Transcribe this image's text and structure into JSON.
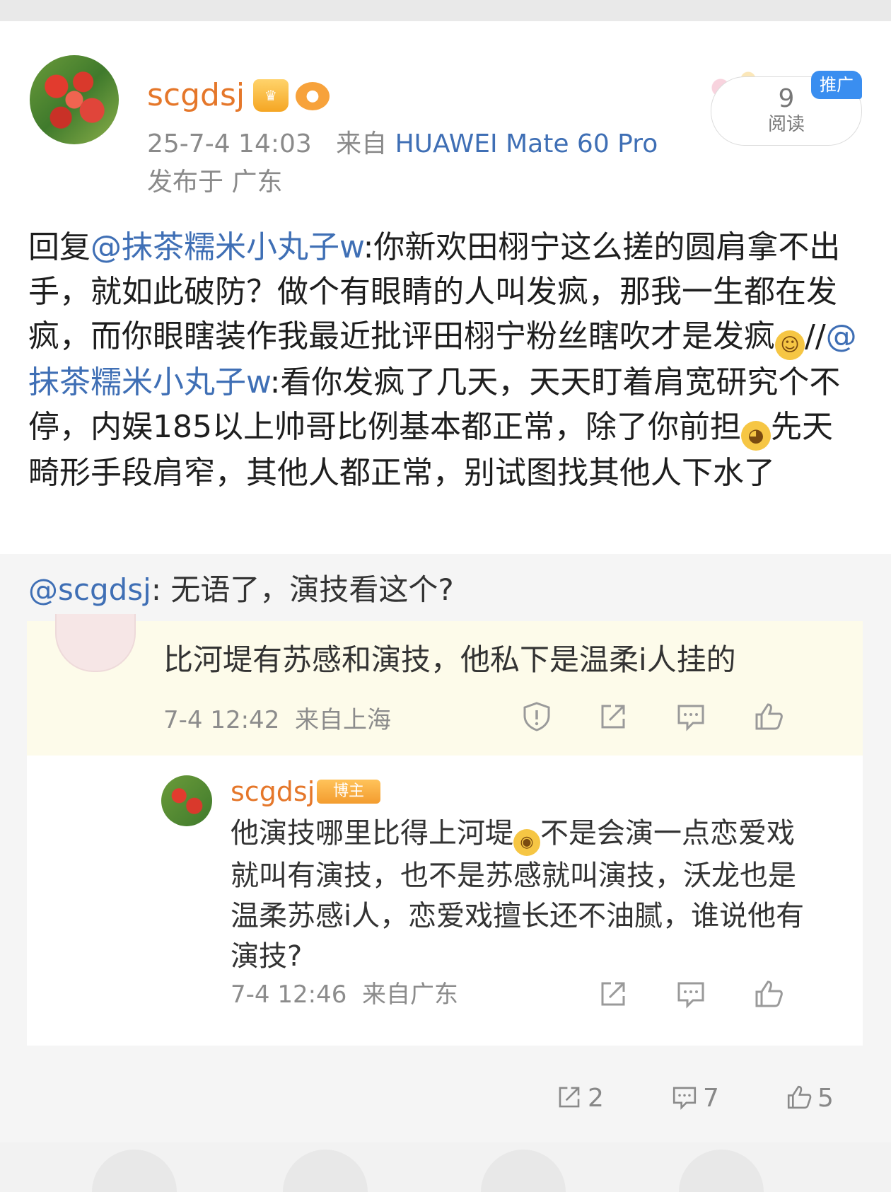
{
  "post": {
    "username": "scgdsj",
    "vip_badge_icon": "crown-vip-icon",
    "fan_badge_icon": "fish-icon",
    "timestamp": "25-7-4 14:03",
    "source_prefix": "来自",
    "device": "HUAWEI Mate 60 Pro",
    "location": "发布于 广东",
    "read_count": "9",
    "read_label": "阅读",
    "promo_label": "推广",
    "body": {
      "p1": "回复",
      "m1": "@抹茶糯米小丸子w",
      "p2": ":你新欢田栩宁这么搓的圆肩拿不出手，就如此破防？做个有眼睛的人叫发疯，那我一生都在发疯，而你眼瞎装作我最近批评田栩宁粉丝瞎吹才是发疯",
      "p3": "//",
      "m2": "@抹茶糯米小丸子w",
      "p4": ":看你发疯了几天，天天盯着肩宽研究个不停，内娱185以上帅哥比例基本都正常，除了你前担",
      "p5": "先天畸形手段肩窄，其他人都正常，别试图找其他人下水了"
    }
  },
  "quote": {
    "mention": "@scgdsj",
    "text": ": 无语了，演技看这个?"
  },
  "screenshot": {
    "comment1": {
      "text": "比河堤有苏感和演技，他私下是温柔i人挂的",
      "time": "7-4 12:42",
      "location": "来自上海"
    },
    "reply": {
      "name": "scgdsj",
      "badge": "博主",
      "text_a": "他演技哪里比得上河堤",
      "text_b": "不是会演一点恋爱戏就叫有演技，也不是苏感就叫演技，沃龙也是温柔苏感i人，恋爱戏擅长还不油腻，谁说他有演技?",
      "time": "7-4 12:46",
      "location": "来自广东"
    }
  },
  "stats": {
    "reposts": "2",
    "comments": "7",
    "likes": "5"
  },
  "colors": {
    "username": "#e5772a",
    "link": "#3f6fb5",
    "promo": "#3a8ef0"
  }
}
